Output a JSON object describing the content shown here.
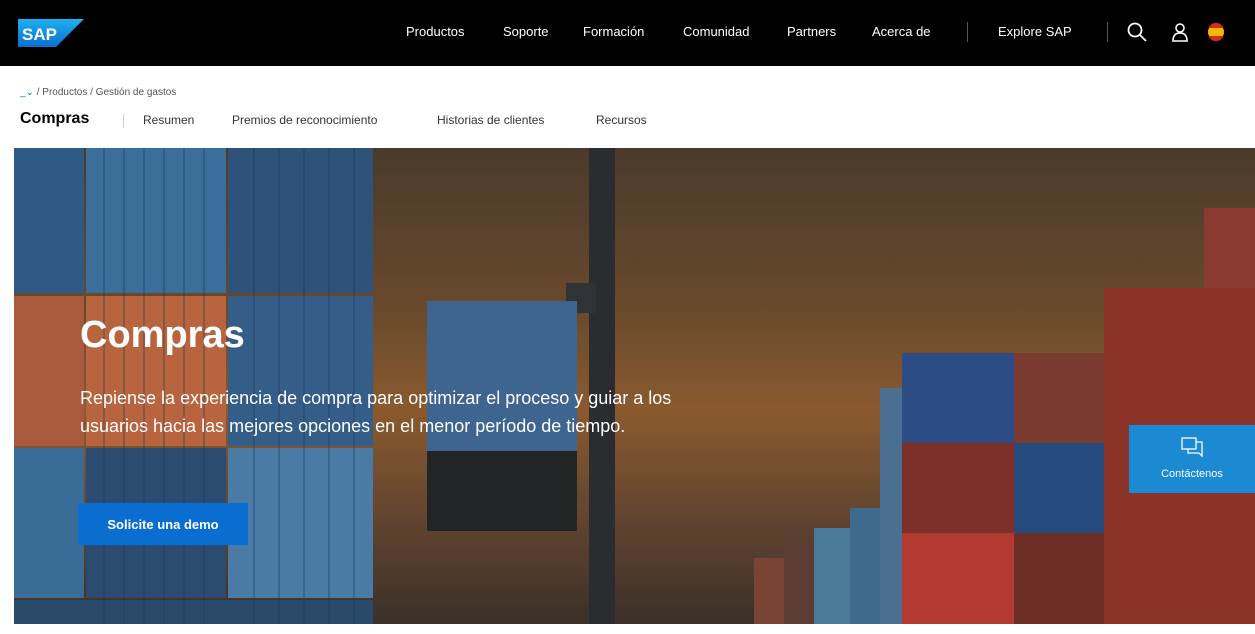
{
  "header": {
    "logo_text": "SAP",
    "nav": [
      "Productos",
      "Soporte",
      "Formación",
      "Comunidad",
      "Partners",
      "Acerca de"
    ],
    "explore_label": "Explore SAP",
    "icons": [
      "search-icon",
      "user-icon",
      "language-flag-icon"
    ]
  },
  "breadcrumb": {
    "home": "_⌄",
    "items": [
      "Productos",
      "Gestión de gastos"
    ],
    "separator": "/"
  },
  "subnav": {
    "title": "Compras",
    "links": [
      "Resumen",
      "Premios de reconocimiento",
      "Historias de clientes",
      "Recursos"
    ]
  },
  "hero": {
    "title": "Compras",
    "description": "Repiense la experiencia de compra para optimizar el proceso y guiar a los usuarios hacia las mejores opciones en el menor período de tiempo.",
    "cta_label": "Solicite una demo"
  },
  "contact": {
    "label": "Contáctenos",
    "icon": "chat-icon"
  },
  "colors": {
    "topbar": "#000000",
    "accent": "#0a6ed1",
    "contact_bg": "#1b8ad3"
  }
}
